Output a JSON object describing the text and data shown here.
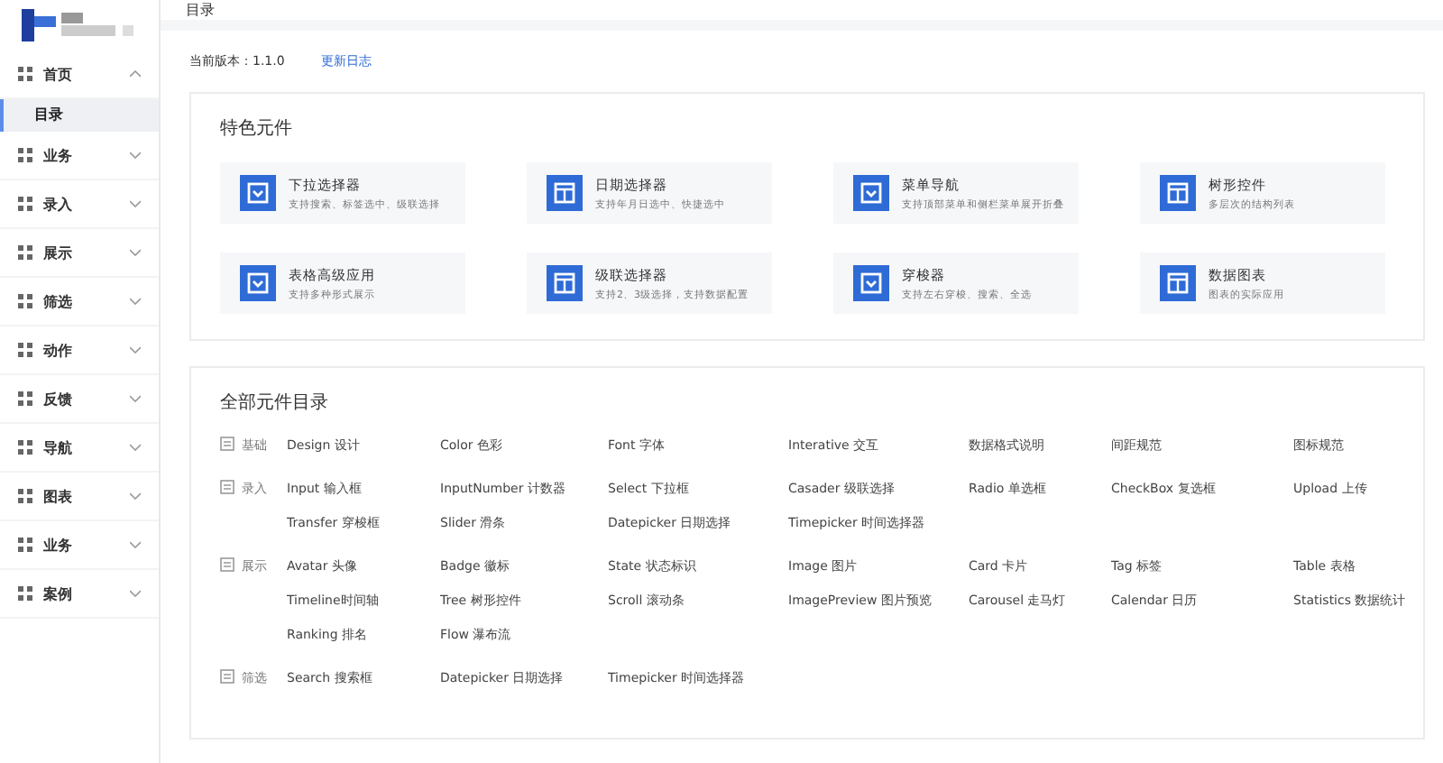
{
  "sidebar": {
    "items": [
      {
        "label": "首页",
        "expanded": true,
        "children": [
          {
            "label": "目录",
            "selected": true
          }
        ]
      },
      {
        "label": "业务",
        "expanded": false
      },
      {
        "label": "录入",
        "expanded": false
      },
      {
        "label": "展示",
        "expanded": false
      },
      {
        "label": "筛选",
        "expanded": false
      },
      {
        "label": "动作",
        "expanded": false
      },
      {
        "label": "反馈",
        "expanded": false
      },
      {
        "label": "导航",
        "expanded": false
      },
      {
        "label": "图表",
        "expanded": false
      },
      {
        "label": "业务",
        "expanded": false
      },
      {
        "label": "案例",
        "expanded": false
      }
    ]
  },
  "header": {
    "title": "目录"
  },
  "version": {
    "label": "当前版本：1.1.0",
    "link": "更新日志"
  },
  "featured": {
    "title": "特色元件",
    "cards": [
      {
        "title": "下拉选择器",
        "desc": "支持搜索、标签选中、级联选择"
      },
      {
        "title": "日期选择器",
        "desc": "支持年月日选中、快捷选中"
      },
      {
        "title": "菜单导航",
        "desc": "支持顶部菜单和侧栏菜单展开折叠"
      },
      {
        "title": "树形控件",
        "desc": "多层次的结构列表"
      },
      {
        "title": "表格高级应用",
        "desc": "支持多种形式展示"
      },
      {
        "title": "级联选择器",
        "desc": "支持2、3级选择，支持数据配置"
      },
      {
        "title": "穿梭器",
        "desc": "支持左右穿梭、搜索、全选"
      },
      {
        "title": "数据图表",
        "desc": "图表的实际应用"
      }
    ]
  },
  "catalog": {
    "title": "全部元件目录",
    "groups": [
      {
        "label": "基础",
        "items": [
          "Design 设计",
          "Color 色彩",
          "Font 字体",
          "Interative 交互",
          "数据格式说明",
          "间距规范",
          "图标规范"
        ]
      },
      {
        "label": "录入",
        "items": [
          "Input 输入框",
          "InputNumber 计数器",
          "Select 下拉框",
          "Casader 级联选择",
          "Radio 单选框",
          "CheckBox 复选框",
          "Upload 上传",
          "Transfer 穿梭框",
          "Slider 滑条",
          "Datepicker 日期选择",
          "Timepicker 时间选择器"
        ]
      },
      {
        "label": "展示",
        "items": [
          "Avatar 头像",
          "Badge 徽标",
          "State 状态标识",
          "Image 图片",
          "Card 卡片",
          "Tag 标签",
          "Table 表格",
          "Timeline时间轴",
          "Tree 树形控件",
          "Scroll 滚动条",
          "ImagePreview 图片预览",
          "Carousel 走马灯",
          "Calendar 日历",
          "Statistics 数据统计",
          "Ranking 排名",
          "Flow 瀑布流"
        ]
      },
      {
        "label": "筛选",
        "items": [
          "Search 搜索框",
          "Datepicker 日期选择",
          "Timepicker 时间选择器"
        ]
      }
    ]
  }
}
